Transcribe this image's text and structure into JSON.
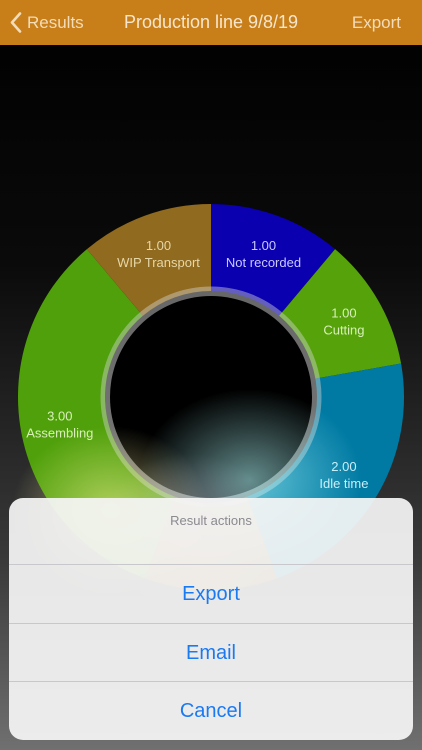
{
  "navbar": {
    "back_label": "Results",
    "title": "Production line 9/8/19",
    "export_label": "Export"
  },
  "chart_data": {
    "type": "pie",
    "segments": [
      {
        "value_label": "1.00",
        "name": "Not recorded",
        "value": 1.0,
        "color": "#0a00b0",
        "text_color": "#c9c9ff"
      },
      {
        "value_label": "1.00",
        "name": "Cutting",
        "value": 1.0,
        "color": "#55a20a",
        "text_color": "#d8f0b8"
      },
      {
        "value_label": "2.00",
        "name": "Idle time",
        "value": 2.0,
        "color": "#007aa3",
        "text_color": "#c9ecf8"
      },
      {
        "value_label": "",
        "name": "",
        "value": 1.0,
        "color": "#8d6a20",
        "text_color": "#e6d6a8"
      },
      {
        "value_label": "3.00",
        "name": "Assembling",
        "value": 3.0,
        "color": "#4fa00a",
        "text_color": "#d8f0b8"
      },
      {
        "value_label": "1.00",
        "name": "WIP Transport",
        "value": 1.0,
        "color": "#906a1e",
        "text_color": "#e6d6a8"
      }
    ]
  },
  "sheet": {
    "title": "Result actions",
    "export_label": "Export",
    "email_label": "Email",
    "cancel_label": "Cancel"
  },
  "colors": {
    "navbar": "#c87f1a",
    "action_text": "#1a7af2"
  }
}
